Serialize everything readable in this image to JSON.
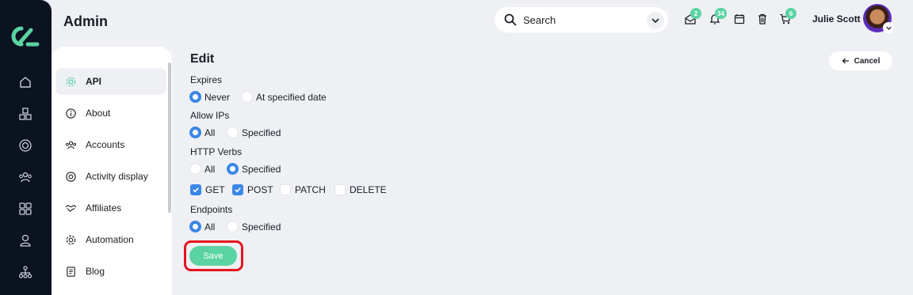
{
  "app": {
    "page_title": "Admin"
  },
  "colors": {
    "accent": "#5bd3a2",
    "radio_selected": "#3b86e6",
    "highlight": "#e4151f",
    "rail": "#0b1220"
  },
  "rail": {
    "icons": [
      "home-icon",
      "boxes-icon",
      "target-icon",
      "users-icon",
      "grid-icon",
      "user-icon",
      "sitemap-icon"
    ]
  },
  "header": {
    "search_placeholder": "Search",
    "badges": {
      "messages": "2",
      "notifications": "34",
      "cart": "6"
    },
    "user_name": "Julie Scott"
  },
  "sidebar": {
    "items": [
      {
        "label": "API",
        "icon": "gear-icon",
        "active": true
      },
      {
        "label": "About",
        "icon": "info-icon"
      },
      {
        "label": "Accounts",
        "icon": "users-icon"
      },
      {
        "label": "Activity display",
        "icon": "target-icon"
      },
      {
        "label": "Affiliates",
        "icon": "handshake-icon"
      },
      {
        "label": "Automation",
        "icon": "gear-icon"
      },
      {
        "label": "Blog",
        "icon": "document-icon"
      }
    ]
  },
  "form": {
    "title": "Edit",
    "cancel_label": "Cancel",
    "expires": {
      "label": "Expires",
      "options": [
        "Never",
        "At specified date"
      ],
      "selected": "Never"
    },
    "allow_ips": {
      "label": "Allow IPs",
      "options": [
        "All",
        "Specified"
      ],
      "selected": "All"
    },
    "http_verbs": {
      "label": "HTTP Verbs",
      "options": [
        "All",
        "Specified"
      ],
      "selected": "Specified",
      "verbs": [
        {
          "label": "GET",
          "checked": true
        },
        {
          "label": "POST",
          "checked": true
        },
        {
          "label": "PATCH",
          "checked": false
        },
        {
          "label": "DELETE",
          "checked": false
        }
      ]
    },
    "endpoints": {
      "label": "Endpoints",
      "options": [
        "All",
        "Specified"
      ],
      "selected": "All"
    },
    "save_label": "Save"
  }
}
